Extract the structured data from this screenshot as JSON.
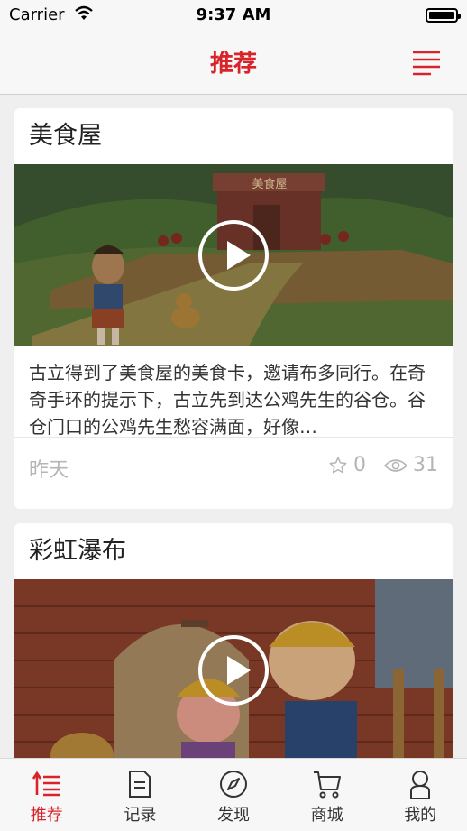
{
  "status_bar": {
    "carrier": "Carrier",
    "time": "9:37 AM"
  },
  "navbar": {
    "title": "推荐",
    "menu_icon": "menu-lines-icon"
  },
  "cards": [
    {
      "title": "美食屋",
      "description": "古立得到了美食屋的美食卡，邀请布多同行。在奇奇手环的提示下，古立先到达公鸡先生的谷仓。谷仓门口的公鸡先生愁容满面，好像…",
      "date": "昨天",
      "favorites": "0",
      "views": "31",
      "sign_text": "美食屋"
    },
    {
      "title": "彩虹瀑布"
    }
  ],
  "tabbar": {
    "items": [
      {
        "label": "推荐",
        "icon": "recommend-icon",
        "active": true
      },
      {
        "label": "记录",
        "icon": "record-icon",
        "active": false
      },
      {
        "label": "发现",
        "icon": "compass-icon",
        "active": false
      },
      {
        "label": "商城",
        "icon": "cart-icon",
        "active": false
      },
      {
        "label": "我的",
        "icon": "profile-icon",
        "active": false
      }
    ]
  },
  "colors": {
    "accent": "#d8232a",
    "background": "#efefef"
  }
}
